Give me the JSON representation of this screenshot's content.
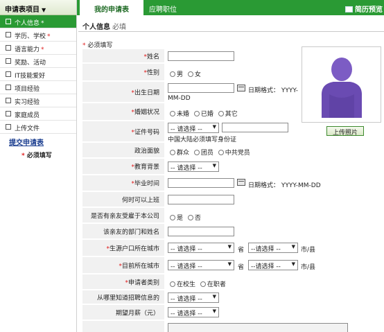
{
  "sidebar": {
    "header": "申请表项目",
    "items": [
      {
        "label": "个人信息",
        "required": true,
        "active": true
      },
      {
        "label": "学历、学校",
        "required": true
      },
      {
        "label": "语言能力",
        "required": true
      },
      {
        "label": "奖励、活动"
      },
      {
        "label": "IT技能爱好"
      },
      {
        "label": "项目经验"
      },
      {
        "label": "实习经验"
      },
      {
        "label": "家庭成员"
      },
      {
        "label": "上传文件"
      }
    ],
    "submit": "提交申请表",
    "required_note": "必须填写"
  },
  "tabs": {
    "active": "我的申请表",
    "second": "应聘职位",
    "preview": "简历预览"
  },
  "section": {
    "title": "个人信息",
    "subtitle": "必填"
  },
  "required_heading": "必须填写",
  "fields": {
    "name": "姓名",
    "gender": "性别",
    "gender_options": [
      "男",
      "女"
    ],
    "birth": "出生日期",
    "birth_hint": "日期格式： YYYY-",
    "birth_hint2": "MM-DD",
    "marital": "婚姻状况",
    "marital_options": [
      "未婚",
      "已婚",
      "其它"
    ],
    "id_doc": "证件号码",
    "id_select": "-- 请选择 --",
    "id_hint": "中国大陆必须填写身份证",
    "politics": "政治面貌",
    "politics_options": [
      "群众",
      "团员",
      "中共党员"
    ],
    "education": "教育背景",
    "education_select": "-- 请选择 --",
    "grad": "毕业时间",
    "grad_hint": "日期格式： YYYY-MM-DD",
    "start": "何时可以上班",
    "relative": "是否有亲友受雇于本公司",
    "relative_options": [
      "是",
      "否"
    ],
    "relative_dept": "该亲友的部门和姓名",
    "hukou": "生源户口所在城市",
    "current_city": "目前所在城市",
    "province_select": "-- 请选择 --",
    "province_unit": "省",
    "city_select": "--请选择 --",
    "city_unit": "市/县",
    "applicant_type": "申请者类别",
    "applicant_options": [
      "在校生",
      "在职者"
    ],
    "source": "从哪里知道招聘信息的",
    "source_select": "-- 请选择 --",
    "salary": "期望月薪（元）",
    "salary_select": "-- 请选择 --"
  },
  "photo": {
    "upload": "上传照片"
  }
}
